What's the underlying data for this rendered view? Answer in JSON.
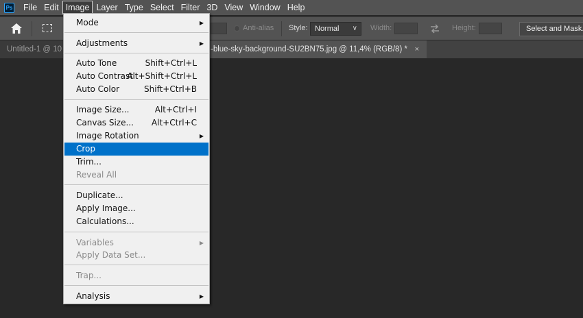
{
  "menubar": {
    "logo": "Ps",
    "items": [
      "File",
      "Edit",
      "Image",
      "Layer",
      "Type",
      "Select",
      "Filter",
      "3D",
      "View",
      "Window",
      "Help"
    ],
    "active": "Image"
  },
  "options_bar": {
    "anti_alias_label": "Anti-alias",
    "style_label": "Style:",
    "style_value": "Normal",
    "width_label": "Width:",
    "height_label": "Height:",
    "select_and_mask_label": "Select and Mask..."
  },
  "tabs": [
    {
      "label": "Untitled-1 @ 10"
    },
    {
      "label": "-blue-sky-background-SU2BN75.jpg @ 11,4% (RGB/8) *",
      "close": "×"
    }
  ],
  "image_menu": {
    "mode": "Mode",
    "adjustments": "Adjustments",
    "auto_tone": {
      "label": "Auto Tone",
      "shortcut": "Shift+Ctrl+L"
    },
    "auto_contrast": {
      "label": "Auto Contrast",
      "shortcut": "Alt+Shift+Ctrl+L"
    },
    "auto_color": {
      "label": "Auto Color",
      "shortcut": "Shift+Ctrl+B"
    },
    "image_size": {
      "label": "Image Size...",
      "shortcut": "Alt+Ctrl+I"
    },
    "canvas_size": {
      "label": "Canvas Size...",
      "shortcut": "Alt+Ctrl+C"
    },
    "image_rotation": "Image Rotation",
    "crop": "Crop",
    "trim": "Trim...",
    "reveal_all": "Reveal All",
    "duplicate": "Duplicate...",
    "apply_image": "Apply Image...",
    "calculations": "Calculations...",
    "variables": "Variables",
    "apply_data_set": "Apply Data Set...",
    "trap": "Trap...",
    "analysis": "Analysis"
  },
  "colors": {
    "highlight": "#0071c9",
    "menubar": "#535353",
    "workspace": "#282828"
  }
}
